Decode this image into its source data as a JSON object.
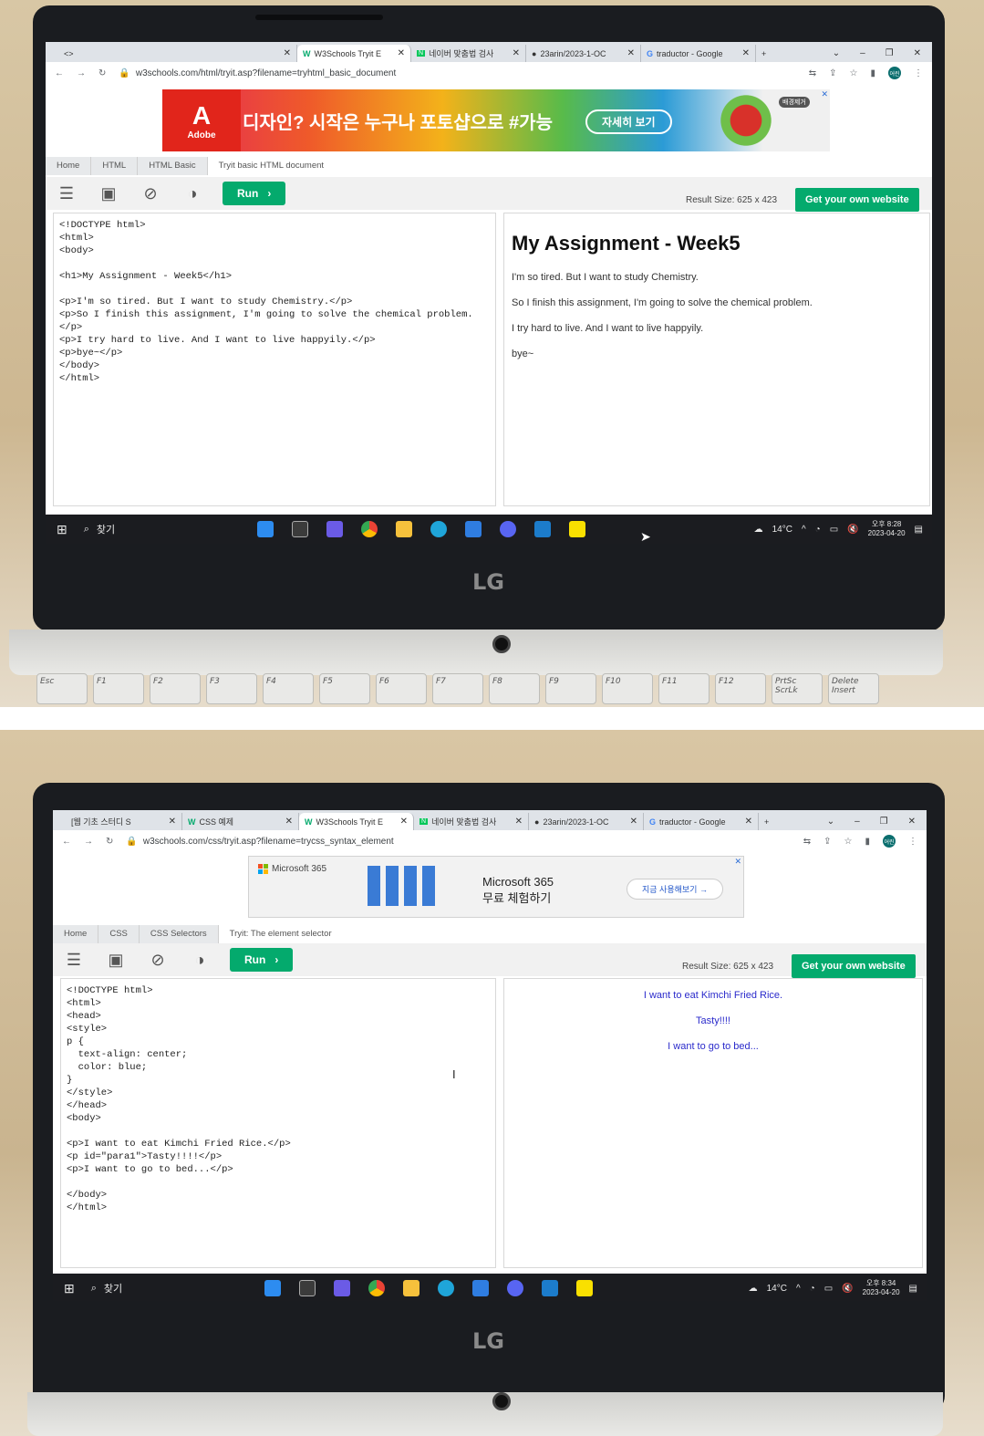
{
  "photo1": {
    "tabs": [
      {
        "label": "<>",
        "close": "✕"
      },
      {
        "label": "W3Schools Tryit E",
        "close": "✕"
      },
      {
        "label": "네이버 맞춤법 검사",
        "close": "✕"
      },
      {
        "label": "23arin/2023-1-OC",
        "close": "✕"
      },
      {
        "label": "traductor - Google",
        "close": "✕"
      }
    ],
    "new_tab": "+",
    "url": "w3schools.com/html/tryit.asp?filename=tryhtml_basic_document",
    "avatar": "어린",
    "ad": {
      "brand": "Adobe",
      "headline": "디자인? 시작은 누구나 포토샵으로 #가능",
      "cta": "자세히 보기",
      "badge": "배경제거"
    },
    "breadcrumbs": [
      "Home",
      "HTML",
      "HTML Basic",
      "Tryit basic HTML document"
    ],
    "run_label": "Run",
    "result_size": "Result Size: 625 x 423",
    "own_site": "Get your own website",
    "code": "<!DOCTYPE html>\n<html>\n<body>\n\n<h1>My Assignment - Week5</h1>\n\n<p>I'm so tired. But I want to study Chemistry.</p>\n<p>So I finish this assignment, I'm going to solve the chemical problem.\n</p>\n<p>I try hard to live. And I want to live happyily.</p>\n<p>bye~</p>\n</body>\n</html>",
    "result": {
      "heading": "My Assignment - Week5",
      "paragraphs": [
        "I'm so tired. But I want to study Chemistry.",
        "So I finish this assignment, I'm going to solve the chemical problem.",
        "I try hard to live. And I want to live happyily.",
        "bye~"
      ]
    },
    "taskbar": {
      "search": "찾기",
      "temp": "14°C",
      "time": "오후 8:28",
      "date": "2023-04-20"
    },
    "laptop_logo": "LG",
    "keys": [
      "Esc",
      "F1",
      "F2",
      "F3",
      "F4",
      "F5",
      "F6",
      "F7",
      "F8",
      "F9",
      "F10",
      "F11",
      "F12",
      "PrtSc ScrLk",
      "Delete Insert"
    ]
  },
  "photo2": {
    "tabs": [
      {
        "label": "[웹 기초 스터디 S",
        "close": "✕"
      },
      {
        "label": "CSS 예제",
        "close": "✕"
      },
      {
        "label": "W3Schools Tryit E",
        "close": "✕"
      },
      {
        "label": "네이버 맞춤법 검사",
        "close": "✕"
      },
      {
        "label": "23arin/2023-1-OC",
        "close": "✕"
      },
      {
        "label": "traductor - Google",
        "close": "✕"
      }
    ],
    "new_tab": "+",
    "url": "w3schools.com/css/tryit.asp?filename=trycss_syntax_element",
    "avatar": "어린",
    "ad": {
      "brand": "Microsoft 365",
      "headline_1": "Microsoft 365",
      "headline_2": "무료 체험하기",
      "cta": "지금 사용해보기 →"
    },
    "breadcrumbs": [
      "Home",
      "CSS",
      "CSS Selectors",
      "Tryit: The element selector"
    ],
    "run_label": "Run",
    "result_size": "Result Size: 625 x 423",
    "own_site": "Get your own website",
    "code": "<!DOCTYPE html>\n<html>\n<head>\n<style>\np {\n  text-align: center;\n  color: blue;\n}\n</style>\n</head>\n<body>\n\n<p>I want to eat Kimchi Fried Rice.</p>\n<p id=\"para1\">Tasty!!!!</p>\n<p>I want to go to bed...</p>\n\n</body>\n</html>",
    "result": {
      "paragraphs": [
        "I want to eat Kimchi Fried Rice.",
        "Tasty!!!!",
        "I want to go to bed..."
      ]
    },
    "taskbar": {
      "search": "찾기",
      "temp": "14°C",
      "time": "오후 8:34",
      "date": "2023-04-20"
    },
    "laptop_logo": "LG"
  }
}
